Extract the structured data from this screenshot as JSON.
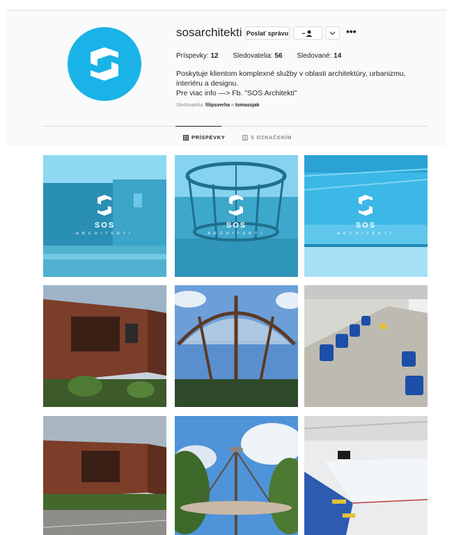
{
  "profile": {
    "username": "sosarchitekti",
    "message_button": "Poslať správu",
    "posts_label": "Príspevky:",
    "posts_count": "12",
    "followers_label": "Sledovatelia:",
    "followers_count": "56",
    "following_label": "Sledované:",
    "following_count": "14",
    "bio_line1": "Poskytuje klientom komplexné služby v oblasti architektúry, urbanizmu, interiéru a designu.",
    "bio_line2": "Pre viac info —> Fb. \"SOS Architekti\"",
    "followed_by_label": "Sledovatelia:",
    "followed_by_user1": "filipsverha",
    "followed_by_conj": "a",
    "followed_by_user2": "tomasojak"
  },
  "tabs": {
    "posts": "PRÍSPEVKY",
    "tagged": "S OZNAČENÍM"
  },
  "overlay": {
    "brand": "SOS",
    "sub": "ARCHITEKTI"
  },
  "colors": {
    "accent": "#1ab3e8",
    "text": "#262626",
    "muted": "#8e8e8e",
    "border": "#dbdbdb"
  },
  "icons": [
    "sos-logo-icon",
    "follow-user-icon",
    "chevron-down-icon",
    "more-options-icon",
    "grid-icon",
    "tagged-icon"
  ],
  "grid": {
    "posts": [
      {
        "subject": "brick building",
        "branded": true
      },
      {
        "subject": "circular pergola",
        "branded": true
      },
      {
        "subject": "ice rink",
        "branded": true
      },
      {
        "subject": "brick building",
        "branded": false
      },
      {
        "subject": "circular pergola",
        "branded": false
      },
      {
        "subject": "stadium seats",
        "branded": false
      },
      {
        "subject": "brick building",
        "branded": false
      },
      {
        "subject": "pergola with trees",
        "branded": false
      },
      {
        "subject": "ice rink",
        "branded": false
      }
    ]
  }
}
